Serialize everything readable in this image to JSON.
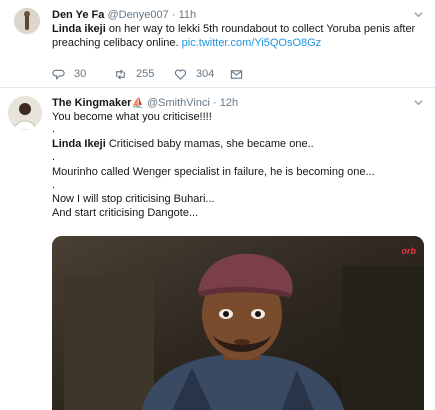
{
  "tweet1": {
    "display_name": "Den Ye Fa",
    "handle": "@Denye007",
    "time": "11h",
    "text_bold": "Linda ikeji",
    "text_line1": " on her way to lekki 5th roundabout to collect Yoruba penis after",
    "text_line2": "preaching celibacy online. ",
    "link": "pic.twitter.com/Yi5QOsO8Gz",
    "replies": "30",
    "retweets": "255",
    "likes": "304",
    "icons": [
      "reply-icon",
      "retweet-icon",
      "heart-icon",
      "envelope-icon"
    ]
  },
  "tweet2": {
    "display_name": "The Kingmaker",
    "name_emoji": "⛵",
    "handle": "@SmithVinci",
    "time": "12h",
    "line1": "You become what you criticise!!!!",
    "dot": ".",
    "line2_bold": "Linda Ikeji",
    "line2": " Criticised baby mamas, she became one..",
    "line3": "Mourinho called Wenger specialist in failure, he is becoming one...",
    "line4": "Now I will stop criticising Buhari...",
    "line5": "And start criticising Dangote...",
    "media_watermark": "orb"
  },
  "colors": {
    "link": "#1b95e0",
    "muted": "#657786",
    "text": "#14171a",
    "divider": "#e1e8ed"
  }
}
